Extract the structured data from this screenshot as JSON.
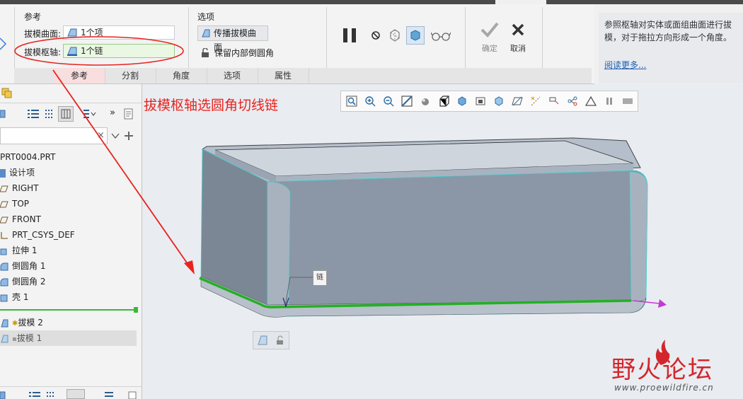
{
  "ribbon": {
    "references_group": {
      "title": "参考",
      "draft_surfaces_label": "拔模曲面:",
      "draft_surfaces_value": "1个项",
      "draft_hinges_label": "拔模枢轴:",
      "draft_hinges_value": "1个链"
    },
    "options_group": {
      "title": "选项",
      "propagate_label": "传播拔模曲面",
      "keep_rounds_label": "保留内部倒圆角"
    },
    "confirm_label": "确定",
    "cancel_label": "取消",
    "tabs": [
      "参考",
      "分割",
      "角度",
      "选项",
      "属性"
    ],
    "active_tab": "参考"
  },
  "info_panel": {
    "text": "参照枢轴对实体或面组曲面进行拔模，对于拖拉方向形成一个角度。",
    "link": "阅读更多..."
  },
  "tree": {
    "search_clear": "×",
    "items": [
      {
        "label": "PRT0004.PRT",
        "icon": "part-icon"
      },
      {
        "label": "设计项",
        "icon": "design-items-icon"
      },
      {
        "label": "RIGHT",
        "icon": "datum-plane-icon"
      },
      {
        "label": "TOP",
        "icon": "datum-plane-icon"
      },
      {
        "label": "FRONT",
        "icon": "datum-plane-icon"
      },
      {
        "label": "PRT_CSYS_DEF",
        "icon": "csys-icon"
      },
      {
        "label": "拉伸 1",
        "icon": "extrude-icon"
      },
      {
        "label": "倒圆角 1",
        "icon": "round-icon"
      },
      {
        "label": "倒圆角 2",
        "icon": "round-icon"
      },
      {
        "label": "壳 1",
        "icon": "shell-icon"
      },
      {
        "label": "拔模 2",
        "icon": "draft-icon"
      },
      {
        "label": "拔模 1",
        "icon": "draft-icon"
      }
    ]
  },
  "graphics": {
    "annotation": "拔模枢轴选圆角切线链",
    "hinge_tag": "链"
  },
  "watermark": {
    "text": "野火论坛",
    "url": "www.proewildfire.cn"
  },
  "colors": {
    "highlight_green": "#22b122",
    "annotation_red": "#e8231f",
    "model_gray": "#8b97a6",
    "edge_cyan": "#3fd1d1",
    "link_blue": "#1f5fb4"
  }
}
